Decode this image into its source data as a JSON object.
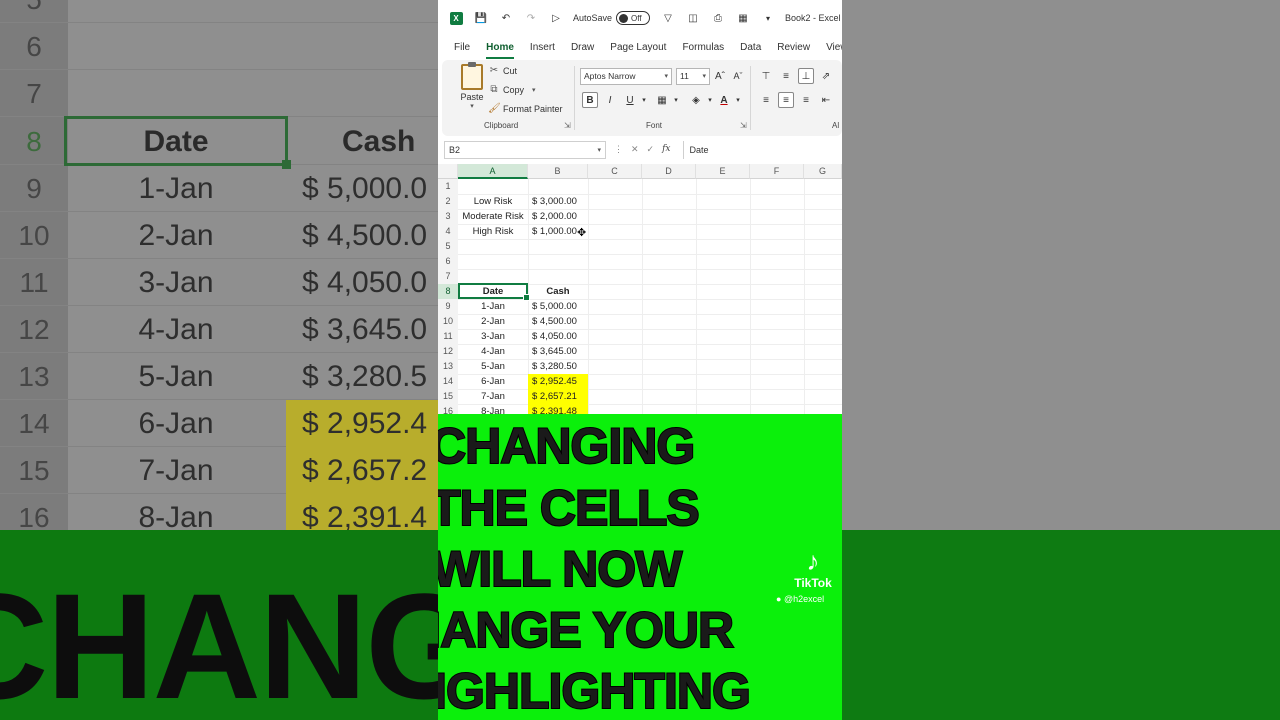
{
  "app": {
    "title": "Book2 - Excel",
    "autosave_label": "AutoSave",
    "autosave_state": "Off"
  },
  "tabs": [
    "File",
    "Home",
    "Insert",
    "Draw",
    "Page Layout",
    "Formulas",
    "Data",
    "Review",
    "View"
  ],
  "ribbon": {
    "paste_label": "Paste",
    "cut_label": "Cut",
    "copy_label": "Copy",
    "format_painter_label": "Format Painter",
    "clipboard_group": "Clipboard",
    "font_name": "Aptos Narrow",
    "font_size": "11",
    "font_group": "Font",
    "alignment_group_partial": "Al",
    "bold_label": "B",
    "italic_label": "I",
    "underline_label": "U"
  },
  "formula_bar": {
    "name_box": "B2",
    "fx_label": "fx",
    "value": "Date"
  },
  "columns": [
    "A",
    "B",
    "C",
    "D",
    "E",
    "F",
    "G"
  ],
  "rows": [
    "1",
    "2",
    "3",
    "4",
    "5",
    "6",
    "7",
    "8",
    "9",
    "10",
    "11",
    "12",
    "13",
    "14",
    "15",
    "16"
  ],
  "cells": {
    "risk_labels": [
      "Low Risk",
      "Moderate Risk",
      "High Risk"
    ],
    "risk_values": [
      "$ 3,000.00",
      "$ 2,000.00",
      "$ 1,000.00"
    ],
    "header_date": "Date",
    "header_cash": "Cash",
    "dates": [
      "1-Jan",
      "2-Jan",
      "3-Jan",
      "4-Jan",
      "5-Jan",
      "6-Jan",
      "7-Jan",
      "8-Jan"
    ],
    "cash": [
      "$ 5,000.00",
      "$ 4,500.00",
      "$ 4,050.00",
      "$ 3,645.00",
      "$ 3,280.50",
      "$ 2,952.45",
      "$ 2,657.21",
      "$ 2,391.48"
    ],
    "highlighted_rows": [
      14,
      15,
      16
    ],
    "highlight_color": "#ffff00"
  },
  "background_zoom": {
    "row_numbers": [
      "5",
      "6",
      "7",
      "8",
      "9",
      "10",
      "11",
      "12",
      "13",
      "14",
      "15",
      "16"
    ],
    "header_date": "Date",
    "header_cash": "Cash",
    "dates": [
      "1-Jan",
      "2-Jan",
      "3-Jan",
      "4-Jan",
      "5-Jan",
      "6-Jan",
      "7-Jan",
      "8-Jan"
    ],
    "cash_partial": [
      "$ 5,000.0",
      "$ 4,500.0",
      "$ 4,050.0",
      "$ 3,645.0",
      "$ 3,280.5",
      "$ 2,952.4",
      "$ 2,657.2",
      "$ 2,391.4"
    ],
    "banner_text": "CHANG"
  },
  "caption": {
    "lines": [
      "CHANGING",
      "THE CELLS",
      "WILL NOW",
      "CHANGE YOUR",
      "HIGHLIGHTING"
    ],
    "color": "#0bf00b"
  },
  "watermark": {
    "brand": "TikTok",
    "handle": "@h2excel"
  },
  "colors": {
    "excel_green": "#107c41",
    "banner_green": "#0bf00b"
  }
}
